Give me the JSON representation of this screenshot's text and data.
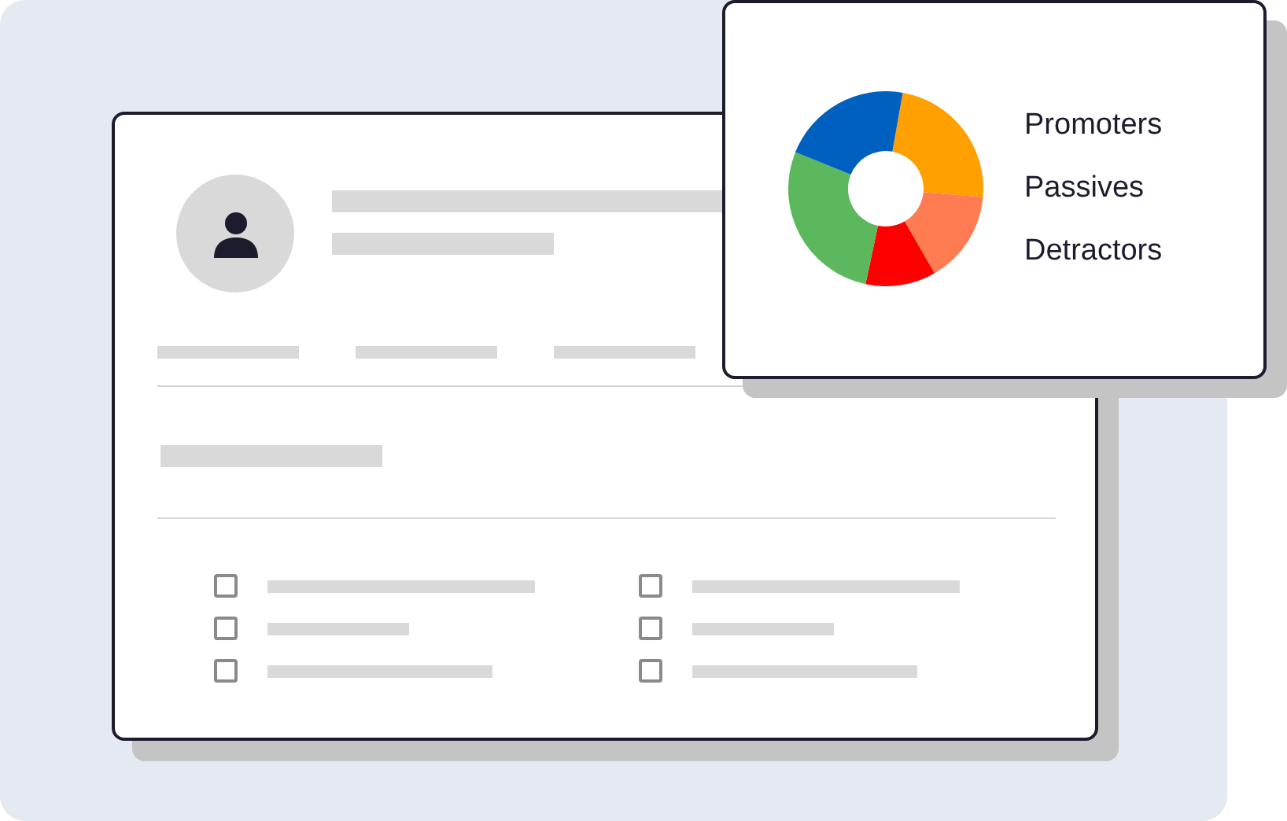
{
  "legend": [
    {
      "label": "Promoters"
    },
    {
      "label": "Passives"
    },
    {
      "label": "Detractors"
    }
  ],
  "checklist": [
    {
      "checked": false
    },
    {
      "checked": false
    },
    {
      "checked": false
    },
    {
      "checked": false
    },
    {
      "checked": false
    },
    {
      "checked": false
    }
  ]
}
